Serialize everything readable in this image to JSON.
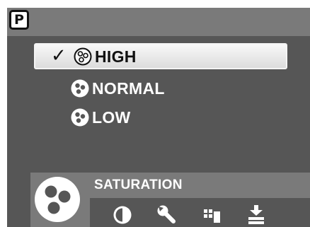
{
  "mode_badge": "P",
  "menu": {
    "items": [
      {
        "label": "HIGH",
        "selected": true
      },
      {
        "label": "NORMAL",
        "selected": false
      },
      {
        "label": "LOW",
        "selected": false
      }
    ],
    "check_mark": "✓",
    "item_icon": "saturation-icon"
  },
  "bottom": {
    "setting_name": "SATURATION",
    "setting_icon": "saturation-icon",
    "tool_icons": [
      "contrast-icon",
      "wrench-icon",
      "frame-stack-icon",
      "download-icon"
    ]
  },
  "colors": {
    "screen": "#565656",
    "bar": "#7a7a7a",
    "highlight": "#e8e8e8",
    "text_on_dark": "#ffffff",
    "text_on_light": "#111111"
  }
}
